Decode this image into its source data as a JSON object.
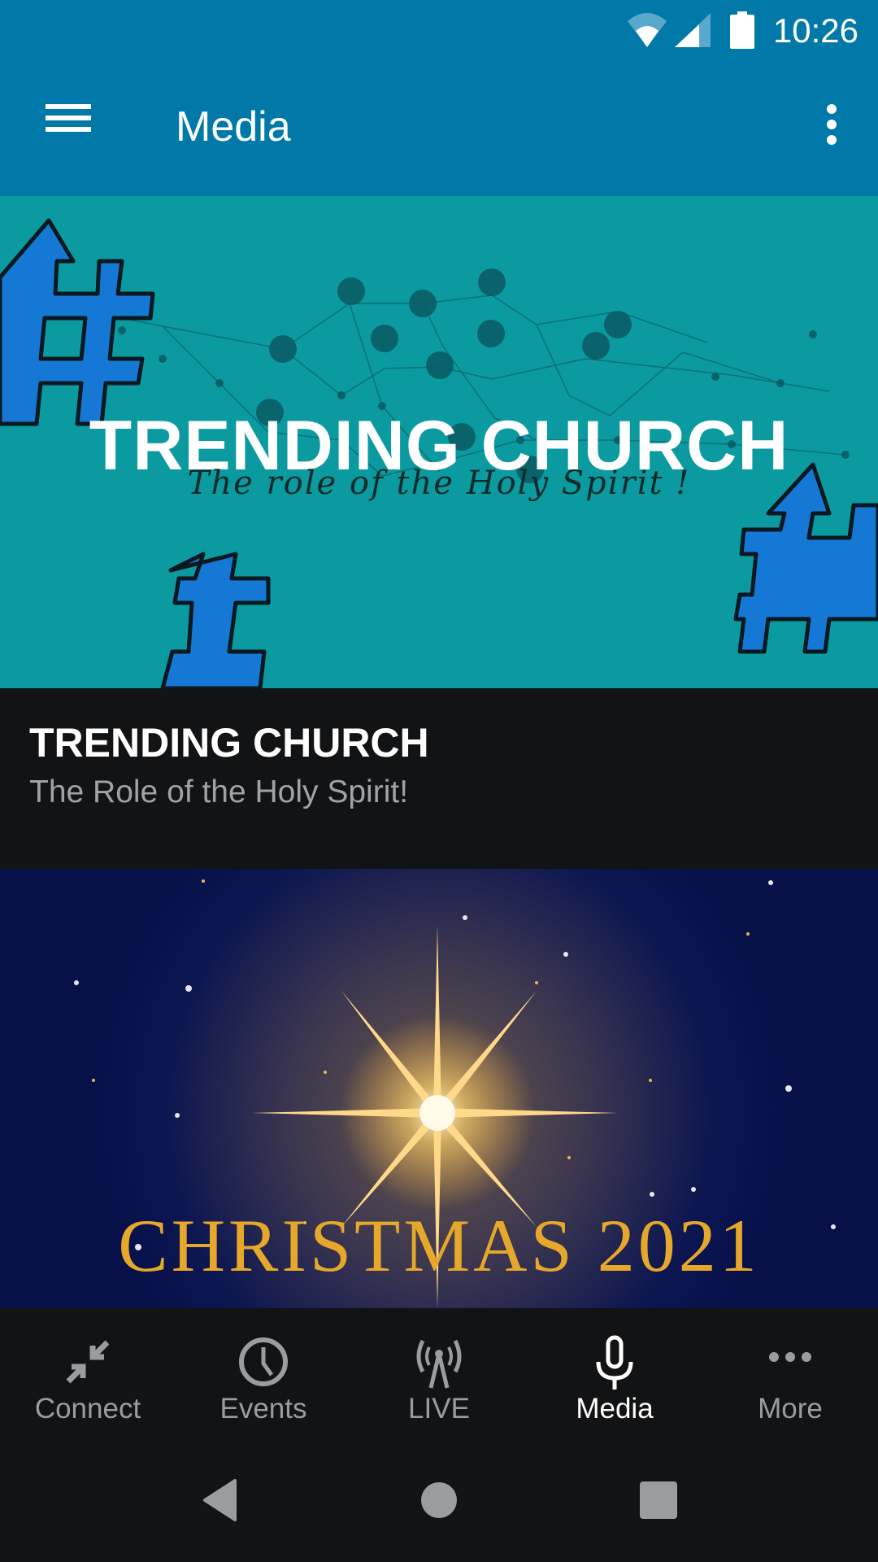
{
  "status_bar": {
    "time": "10:26",
    "icons": [
      "wifi-icon",
      "cell-signal-icon",
      "battery-icon"
    ]
  },
  "app_bar": {
    "title": "Media",
    "menu_icon": "hamburger-menu-icon",
    "overflow_icon": "more-vert-icon"
  },
  "colors": {
    "primary": "#0179a8",
    "background": "#121315",
    "inactive": "#9b9c9e",
    "active": "#ffffff",
    "subtitle": "#a0a2a4"
  },
  "feed": [
    {
      "thumbnail_headline": "TRENDING CHURCH",
      "thumbnail_script": "The role of the Holy Spirit !",
      "title": "TRENDING CHURCH",
      "subtitle": "The Role of the Holy Spirit!"
    },
    {
      "thumbnail_headline": "CHRISTMAS 2021"
    }
  ],
  "bottom_nav": [
    {
      "label": "Connect",
      "icon": "connect-arrows-icon",
      "active": false
    },
    {
      "label": "Events",
      "icon": "clock-icon",
      "active": false
    },
    {
      "label": "LIVE",
      "icon": "broadcast-tower-icon",
      "active": false
    },
    {
      "label": "Media",
      "icon": "microphone-icon",
      "active": true
    },
    {
      "label": "More",
      "icon": "more-horiz-icon",
      "active": false
    }
  ],
  "system_nav": [
    "back-icon",
    "home-icon",
    "recents-icon"
  ]
}
